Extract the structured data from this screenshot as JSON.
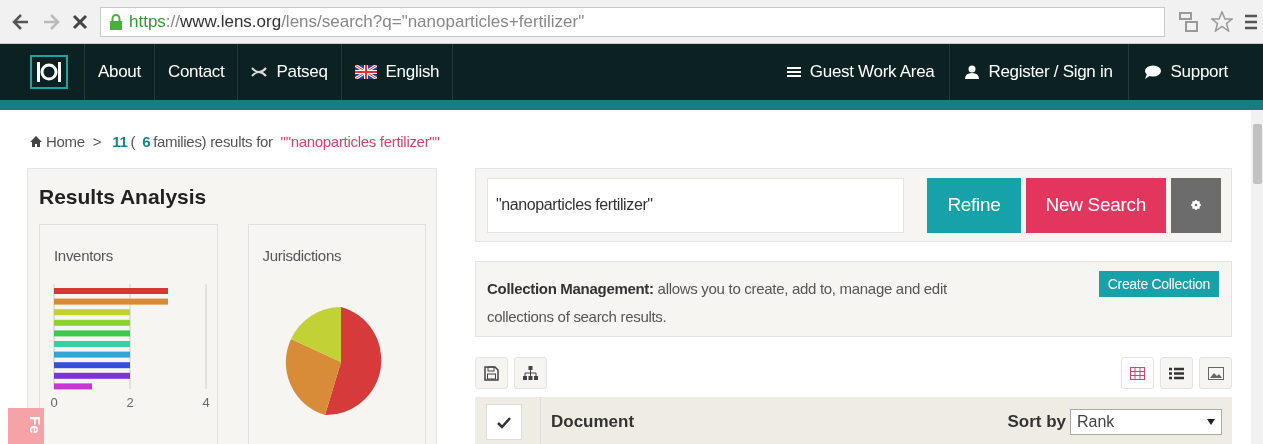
{
  "browser": {
    "url": [
      {
        "kind": "scheme",
        "text": "https"
      },
      {
        "kind": "plain",
        "text": "://"
      },
      {
        "kind": "host",
        "text": "www.lens.org"
      },
      {
        "kind": "plain",
        "text": "/lens/search?q=\"nanoparticles+fertilizer\""
      }
    ]
  },
  "nav": {
    "left": [
      {
        "kind": "logo"
      },
      {
        "kind": "link",
        "label": "About"
      },
      {
        "kind": "link",
        "label": "Contact"
      },
      {
        "kind": "link",
        "label": "Patseq"
      },
      {
        "kind": "link",
        "label": "English"
      }
    ],
    "right": [
      {
        "kind": "link",
        "label": "Guest Work Area"
      },
      {
        "kind": "link",
        "label": "Register / Sign in"
      },
      {
        "kind": "link",
        "label": "Support"
      }
    ]
  },
  "breadcrumb": {
    "home": "Home",
    "separator": ">",
    "summary": [
      {
        "kind": "count",
        "text": "11"
      },
      {
        "kind": "plain",
        "text": "("
      },
      {
        "kind": "count",
        "text": "6"
      },
      {
        "kind": "plain",
        "text": "families) results for"
      },
      {
        "kind": "query",
        "text": "\"\"nanoparticles fertilizer\"\""
      }
    ]
  },
  "analysis": {
    "title": "Results Analysis",
    "cards": [
      {
        "title": "Inventors",
        "chart_data": {
          "type": "bar",
          "orientation": "horizontal",
          "values": [
            3,
            3,
            2,
            2,
            2,
            2,
            2,
            2,
            2,
            1
          ],
          "xlim": [
            0,
            4
          ],
          "xticks": [
            0,
            2,
            4
          ]
        }
      },
      {
        "title": "Jurisdictions",
        "kind": "pie"
      }
    ]
  },
  "search": {
    "value": "\"nanoparticles fertilizer\"",
    "buttons": [
      {
        "kind": "refine",
        "label": "Refine"
      },
      {
        "kind": "new",
        "label": "New Search"
      },
      {
        "kind": "settings"
      }
    ]
  },
  "collection": {
    "text": "**Collection Management:** allows you to create, add to, manage and edit collections of search results.",
    "button": "Create Collection"
  },
  "tools": {
    "right": [
      {
        "selected": true
      },
      {
        "selected": false
      },
      {
        "selected": false
      }
    ]
  },
  "table": {
    "select_all": true,
    "column": "Document",
    "sort_label": "Sort by",
    "sort_value": "Rank"
  },
  "feedback": {
    "label": "Fe"
  }
}
